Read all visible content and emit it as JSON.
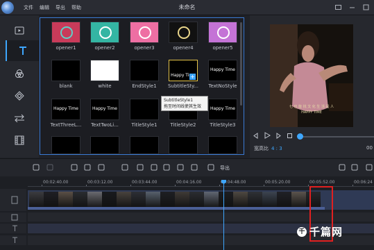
{
  "app": {
    "title": "未命名",
    "menu": [
      "文件",
      "编辑",
      "导出",
      "帮助"
    ]
  },
  "sidebar": {
    "items": [
      {
        "icon": "media-icon"
      },
      {
        "icon": "text-icon",
        "active": true
      },
      {
        "icon": "filters-icon"
      },
      {
        "icon": "overlays-icon"
      },
      {
        "icon": "transitions-icon"
      },
      {
        "icon": "film-icon"
      }
    ]
  },
  "library": {
    "items": [
      {
        "label": "opener1",
        "bg": "#c93b5a",
        "text": "",
        "accent": "#5fd0c8"
      },
      {
        "label": "opener2",
        "bg": "#34b5a3",
        "text": "",
        "accent": "#ffffff"
      },
      {
        "label": "opener3",
        "bg": "#ee6fa3",
        "text": "",
        "accent": "#ffffff"
      },
      {
        "label": "opener4",
        "bg": "#111111",
        "text": "",
        "accent": "#e9d58a"
      },
      {
        "label": "opener5",
        "bg": "#c473d6",
        "text": "",
        "accent": "#ffffff"
      },
      {
        "label": "blank",
        "bg": "#000000",
        "text": "",
        "accent": "#000000"
      },
      {
        "label": "white",
        "bg": "#ffffff",
        "text": "",
        "accent": "#ffffff"
      },
      {
        "label": "EndStyle1",
        "bg": "#000000",
        "text": "",
        "accent": "#ffffff"
      },
      {
        "label": "SubtitleSty...",
        "bg": "#000000",
        "text": "Happy Time",
        "accent": "#3ea7ff",
        "selected": true
      },
      {
        "label": "TextNoStyle",
        "bg": "#000000",
        "text": "Happy Time",
        "accent": "#ffffff"
      },
      {
        "label": "TextThreeL...",
        "bg": "#000000",
        "text": "Happy Time",
        "accent": "#ffffff"
      },
      {
        "label": "TextTwoLi...",
        "bg": "#000000",
        "text": "Happy Time",
        "accent": "#ffffff"
      },
      {
        "label": "TitleStyle1",
        "bg": "#000000",
        "text": "",
        "accent": "#ffffff"
      },
      {
        "label": "TitleStyle2",
        "bg": "#000000",
        "text": "",
        "accent": "#ffffff"
      },
      {
        "label": "TitleStyle3",
        "bg": "#000000",
        "text": "Happy Time",
        "accent": "#ffffff"
      },
      {
        "label": "",
        "bg": "#000000",
        "text": "",
        "accent": "#ffffff"
      },
      {
        "label": "",
        "bg": "#000000",
        "text": "",
        "accent": "#35c6b6"
      },
      {
        "label": "",
        "bg": "#000000",
        "text": "",
        "accent": "#ffffff"
      },
      {
        "label": "",
        "bg": "#000000",
        "text": "",
        "accent": "#ffffff"
      },
      {
        "label": "",
        "bg": "#000000",
        "text": "",
        "accent": "#ffffff"
      }
    ],
    "tooltip": {
      "title": "SubtitleStyle1",
      "hint": "拖至时间线使其生效"
    }
  },
  "preview": {
    "caption": "HAPPY TIME",
    "caption_cn": "七 也 能 找 文 化 生 活 是 人",
    "aspect_label": "宽高比",
    "aspect_value": "4 : 3",
    "zoom_tail": "00"
  },
  "toolbar": {
    "export_label": "导出"
  },
  "timeline": {
    "ticks": [
      "00:02:40.00",
      "00:03:12.00",
      "00:03:44.00",
      "00:04:16.00",
      "00:04:48.00",
      "00:05:20.00",
      "00:05:52.00",
      "00:06:24"
    ]
  },
  "watermark": {
    "logo": "千",
    "text": "千篇网"
  },
  "colors": {
    "accent": "#3ea7ff",
    "highlight": "#e02020"
  }
}
